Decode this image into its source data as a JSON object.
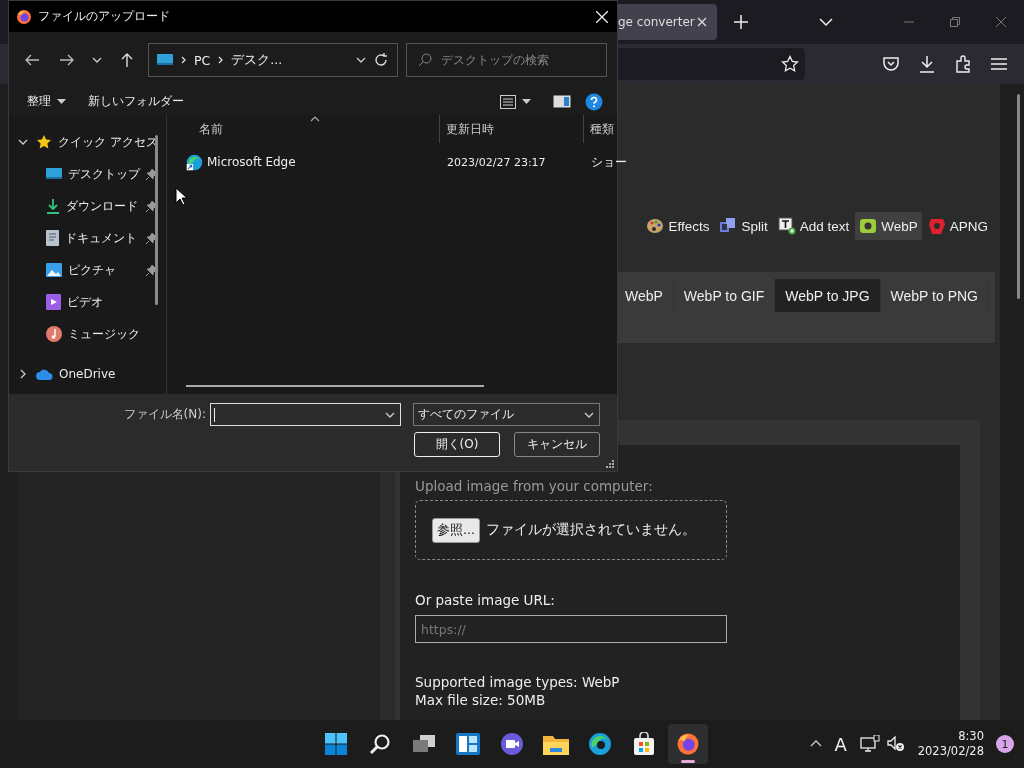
{
  "browser": {
    "tab": {
      "title": "ge converter"
    },
    "nav_items": [
      {
        "label": "Effects",
        "kind": "palette",
        "selected": false
      },
      {
        "label": "Split",
        "kind": "film",
        "selected": false
      },
      {
        "label": "Add text",
        "kind": "text",
        "selected": false
      },
      {
        "label": "WebP",
        "kind": "webp",
        "selected": true
      },
      {
        "label": "APNG",
        "kind": "apng",
        "selected": false
      }
    ],
    "subtabs": [
      {
        "label": "WebP",
        "selected": false
      },
      {
        "label": "WebP to GIF",
        "selected": false
      },
      {
        "label": "WebP to JPG",
        "selected": true
      },
      {
        "label": "WebP to PNG",
        "selected": false
      }
    ],
    "upload": {
      "label": "Upload image from your computer:",
      "browse_button": "参照...",
      "status": "ファイルが選択されていません。"
    },
    "url": {
      "label": "Or paste image URL:",
      "placeholder": "https://"
    },
    "info": [
      "Supported image types: WebP",
      "Max file size: 50MB"
    ]
  },
  "dialog": {
    "title": "ファイルのアップロード",
    "path": [
      "PC",
      "デスク..."
    ],
    "search": {
      "placeholder": "デスクトップの検索"
    },
    "commands": {
      "organize": "整理",
      "new_folder": "新しいフォルダー"
    },
    "tree": [
      {
        "label": "クイック アクセス",
        "kind": "star",
        "expanded": true,
        "children": [
          {
            "label": "デスクトップ",
            "kind": "desktop",
            "pinned": true
          },
          {
            "label": "ダウンロード",
            "kind": "download",
            "pinned": true
          },
          {
            "label": "ドキュメント",
            "kind": "document",
            "pinned": true
          },
          {
            "label": "ピクチャ",
            "kind": "picture",
            "pinned": true
          },
          {
            "label": "ビデオ",
            "kind": "video",
            "pinned": false
          },
          {
            "label": "ミュージック",
            "kind": "music",
            "pinned": false
          }
        ]
      },
      {
        "label": "OneDrive",
        "kind": "cloud",
        "expanded": false
      }
    ],
    "columns": [
      "名前",
      "更新日時",
      "種類"
    ],
    "rows": [
      {
        "name": "Microsoft Edge",
        "date": "2023/02/27 23:17",
        "type": "ショー"
      }
    ],
    "filename_label": "ファイル名(N):",
    "filter": "すべてのファイル",
    "buttons": [
      {
        "label": "開く(O)",
        "default": true
      },
      {
        "label": "キャンセル",
        "default": false
      }
    ]
  },
  "taskbar": {
    "apps": [
      {
        "kind": "start",
        "active": false
      },
      {
        "kind": "search",
        "active": false
      },
      {
        "kind": "taskview",
        "active": false
      },
      {
        "kind": "widgets",
        "active": false
      },
      {
        "kind": "chat",
        "active": false
      },
      {
        "kind": "explorer",
        "active": false
      },
      {
        "kind": "edge",
        "active": false
      },
      {
        "kind": "store",
        "active": false
      },
      {
        "kind": "firefox",
        "active": true
      }
    ],
    "ime": "A",
    "time": "8:30",
    "date": "2023/02/28",
    "badge": "1"
  }
}
